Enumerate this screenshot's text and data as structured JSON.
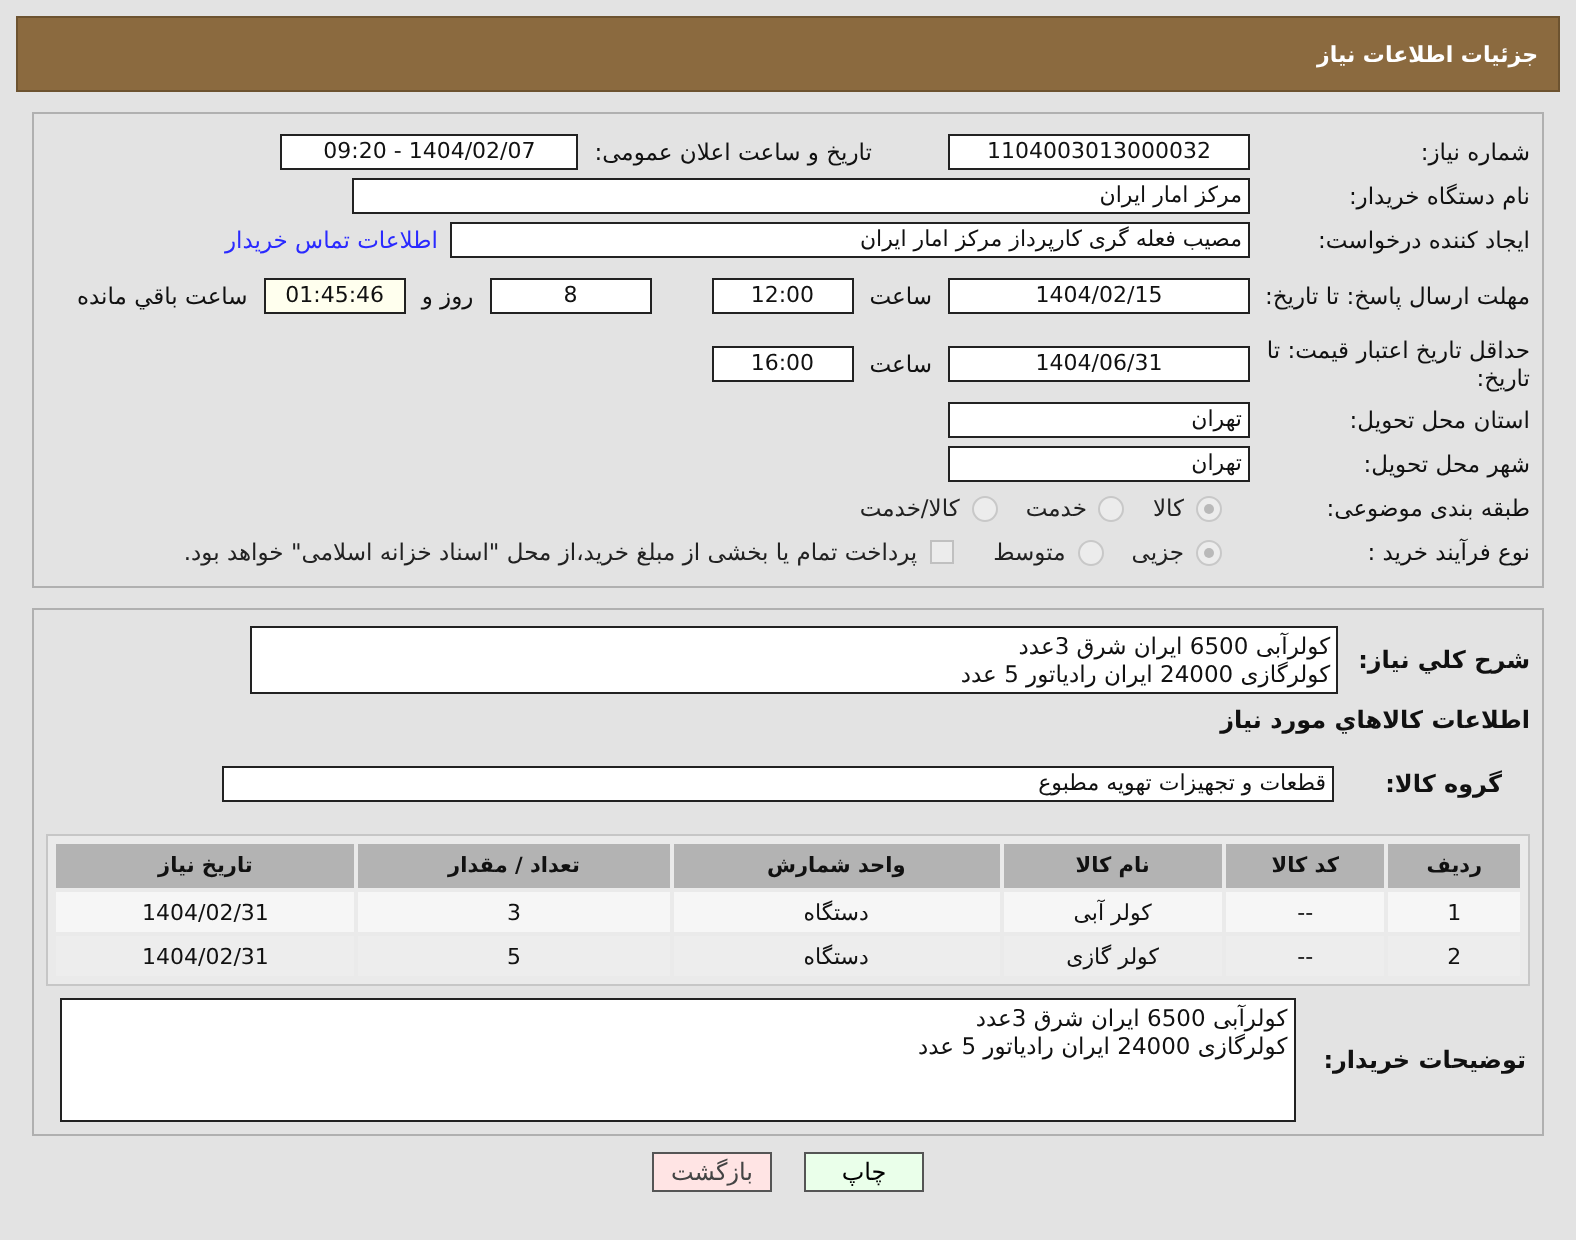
{
  "header": {
    "title": "جزئیات اطلاعات نیاز"
  },
  "details": {
    "need_number": {
      "label": "شماره نیاز:",
      "value": "1104003013000032"
    },
    "announce": {
      "label": "تاریخ و ساعت اعلان عمومی:",
      "value": "1404/02/07 - 09:20"
    },
    "buyer": {
      "label": "نام دستگاه خریدار:",
      "value": "مرکز امار ایران"
    },
    "creator": {
      "label": "ایجاد کننده درخواست:",
      "value": "مصیب فعله گری کارپرداز مرکز امار ایران",
      "link": "اطلاعات تماس خریدار"
    },
    "deadline": {
      "label": "مهلت ارسال پاسخ: تا تاریخ:",
      "date": "1404/02/15",
      "time_label": "ساعت",
      "time": "12:00",
      "days": "8",
      "days_label": "روز و",
      "remaining": "01:45:46",
      "remaining_label": "ساعت باقي مانده"
    },
    "validity": {
      "label": "حداقل تاریخ اعتبار قیمت: تا تاریخ:",
      "date": "1404/06/31",
      "time_label": "ساعت",
      "time": "16:00"
    },
    "province": {
      "label": "استان محل تحویل:",
      "value": "تهران"
    },
    "city": {
      "label": "شهر محل تحویل:",
      "value": "تهران"
    },
    "category": {
      "label": "طبقه بندی موضوعی:",
      "options": [
        {
          "label": "کالا",
          "selected": true
        },
        {
          "label": "خدمت",
          "selected": false
        },
        {
          "label": "کالا/خدمت",
          "selected": false
        }
      ]
    },
    "process": {
      "label": "نوع فرآیند خرید :",
      "options": [
        {
          "label": "جزیی",
          "selected": true
        },
        {
          "label": "متوسط",
          "selected": false
        }
      ],
      "treasury": {
        "label": "پرداخت تمام یا بخشی از مبلغ خرید،از محل \"اسناد خزانه اسلامی\" خواهد بود.",
        "checked": false
      }
    }
  },
  "goods": {
    "description": {
      "label": "شرح كلي نياز:",
      "lines": [
        "کولرآبی 6500 ایران شرق 3عدد",
        "کولرگازی 24000 ایران رادیاتور 5 عدد"
      ]
    },
    "heading": "اطلاعات كالاهاي مورد نياز",
    "group": {
      "label": "گروه کالا:",
      "value": "قطعات و تجهیزات تهویه مطبوع"
    },
    "table": {
      "columns": [
        "ردیف",
        "کد کالا",
        "نام کالا",
        "واحد شمارش",
        "تعداد / مقدار",
        "تاریخ نیاز"
      ],
      "rows": [
        [
          "1",
          "--",
          "کولر آبی",
          "دستگاه",
          "3",
          "1404/02/31"
        ],
        [
          "2",
          "--",
          "کولر گازی",
          "دستگاه",
          "5",
          "1404/02/31"
        ]
      ]
    },
    "notes": {
      "label": "توضیحات خریدار:",
      "lines": [
        "کولرآبی 6500 ایران شرق 3عدد",
        "کولرگازی 24000 ایران رادیاتور 5 عدد"
      ]
    }
  },
  "buttons": [
    {
      "label": "چاپ",
      "kind": "print"
    },
    {
      "label": "بازگشت",
      "kind": "back"
    }
  ]
}
